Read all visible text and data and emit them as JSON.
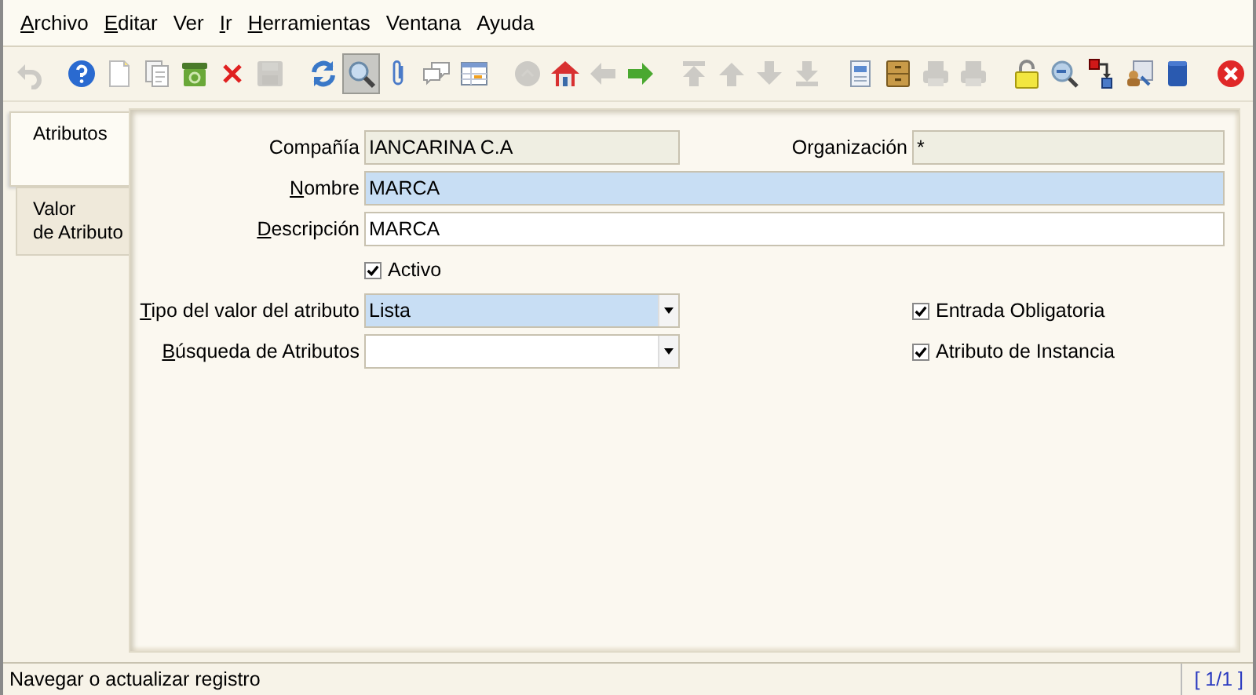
{
  "menu": [
    {
      "label": "Archivo",
      "mnemonic": true
    },
    {
      "label": "Editar",
      "mnemonic": true
    },
    {
      "label": "Ver",
      "mnemonic": false
    },
    {
      "label": "Ir",
      "mnemonic": true
    },
    {
      "label": "Herramientas",
      "mnemonic": true
    },
    {
      "label": "Ventana",
      "mnemonic": false
    },
    {
      "label": "Ayuda",
      "mnemonic": false
    }
  ],
  "toolbar": [
    [
      {
        "kind": "undo",
        "disabled": true,
        "selected": false
      }
    ],
    [
      {
        "kind": "help",
        "disabled": false,
        "selected": false
      },
      {
        "kind": "new",
        "disabled": false,
        "selected": false
      },
      {
        "kind": "copy",
        "disabled": false,
        "selected": false
      },
      {
        "kind": "trash",
        "disabled": false,
        "selected": false
      },
      {
        "kind": "delete",
        "disabled": false,
        "selected": false
      },
      {
        "kind": "save",
        "disabled": true,
        "selected": false
      }
    ],
    [
      {
        "kind": "refresh",
        "disabled": false,
        "selected": false
      },
      {
        "kind": "find",
        "disabled": false,
        "selected": true
      },
      {
        "kind": "attach",
        "disabled": false,
        "selected": false
      },
      {
        "kind": "chat",
        "disabled": false,
        "selected": false
      },
      {
        "kind": "grid",
        "disabled": false,
        "selected": false
      }
    ],
    [
      {
        "kind": "history",
        "disabled": true,
        "selected": false
      },
      {
        "kind": "home",
        "disabled": false,
        "selected": false
      },
      {
        "kind": "back",
        "disabled": true,
        "selected": false
      },
      {
        "kind": "forward",
        "disabled": false,
        "selected": false
      }
    ],
    [
      {
        "kind": "first",
        "disabled": true,
        "selected": false
      },
      {
        "kind": "prev",
        "disabled": true,
        "selected": false
      },
      {
        "kind": "next",
        "disabled": true,
        "selected": false
      },
      {
        "kind": "last",
        "disabled": true,
        "selected": false
      }
    ],
    [
      {
        "kind": "report",
        "disabled": false,
        "selected": false
      },
      {
        "kind": "archive",
        "disabled": false,
        "selected": false
      },
      {
        "kind": "preview",
        "disabled": true,
        "selected": false
      },
      {
        "kind": "print",
        "disabled": true,
        "selected": false
      }
    ],
    [
      {
        "kind": "lock",
        "disabled": false,
        "selected": false
      },
      {
        "kind": "zoom",
        "disabled": false,
        "selected": false
      },
      {
        "kind": "request",
        "disabled": false,
        "selected": false
      },
      {
        "kind": "workflow",
        "disabled": false,
        "selected": false
      },
      {
        "kind": "product",
        "disabled": false,
        "selected": false
      }
    ],
    [
      {
        "kind": "exit",
        "disabled": false,
        "selected": false
      }
    ]
  ],
  "tabs": [
    {
      "label": "Atributos",
      "selected": true
    },
    {
      "label": "Valor\nde Atributo",
      "selected": false
    }
  ],
  "form": [
    [
      {
        "kind": "text",
        "label": "Compañía",
        "mnemonic": false,
        "value": "IANCARINA C.A",
        "readonly": true,
        "mandatory": false,
        "wide": false
      },
      {
        "kind": "text",
        "label": "Organización",
        "mnemonic": false,
        "value": "*",
        "readonly": true,
        "mandatory": false,
        "wide": false
      }
    ],
    [
      {
        "kind": "text",
        "label": "Nombre",
        "mnemonic": true,
        "value": "MARCA",
        "readonly": false,
        "mandatory": true,
        "wide": true
      }
    ],
    [
      {
        "kind": "text",
        "label": "Descripción",
        "mnemonic": true,
        "value": "MARCA",
        "readonly": false,
        "mandatory": false,
        "wide": true
      }
    ],
    [
      {
        "kind": "checkbox",
        "label": "Activo",
        "checked": true
      }
    ],
    [
      {
        "kind": "dropdown",
        "label": "Tipo del valor del atributo",
        "mnemonic": true,
        "value": "Lista",
        "mandatory": true
      },
      {
        "kind": "checkbox",
        "label": "Entrada Obligatoria",
        "checked": true
      }
    ],
    [
      {
        "kind": "dropdown",
        "label": "Búsqueda de Atributos",
        "mnemonic": true,
        "mandatory": false
      },
      {
        "kind": "checkbox",
        "label": "Atributo de Instancia",
        "checked": true
      }
    ]
  ],
  "status_bar": {
    "message": "Navegar o actualizar registro",
    "record": "[ 1/1 ]"
  }
}
